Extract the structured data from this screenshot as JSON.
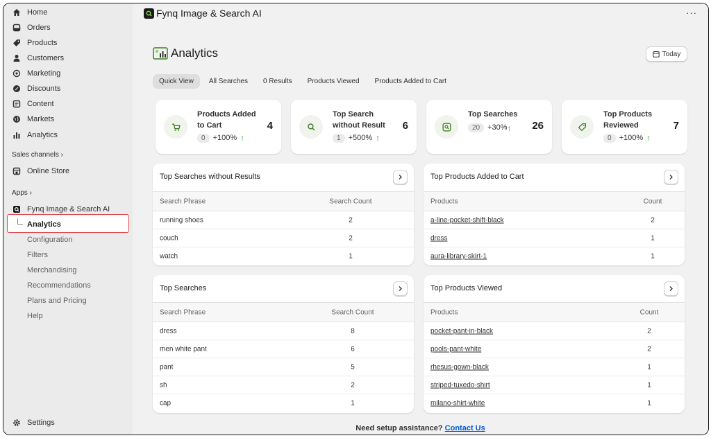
{
  "sidebar": {
    "items": [
      {
        "label": "Home",
        "icon": "home-icon"
      },
      {
        "label": "Orders",
        "icon": "orders-icon"
      },
      {
        "label": "Products",
        "icon": "tag-icon"
      },
      {
        "label": "Customers",
        "icon": "person-icon"
      },
      {
        "label": "Marketing",
        "icon": "target-icon"
      },
      {
        "label": "Discounts",
        "icon": "discount-icon"
      },
      {
        "label": "Content",
        "icon": "content-icon"
      },
      {
        "label": "Markets",
        "icon": "globe-icon"
      },
      {
        "label": "Analytics",
        "icon": "bar-chart-icon"
      }
    ],
    "sales_channels_label": "Sales channels",
    "online_store_label": "Online Store",
    "apps_label": "Apps",
    "app_name": "Fynq Image & Search AI",
    "app_sub_items": [
      "Analytics",
      "Configuration",
      "Filters",
      "Merchandising",
      "Recommendations",
      "Plans and Pricing",
      "Help"
    ],
    "settings_label": "Settings"
  },
  "topbar": {
    "app_title": "Fynq Image & Search AI",
    "more": "···"
  },
  "page": {
    "title": "Analytics",
    "today_label": "Today"
  },
  "tabs": [
    "Quick View",
    "All Searches",
    "0 Results",
    "Products Viewed",
    "Products Added to Cart"
  ],
  "stats": [
    {
      "label": "Products Added to Cart",
      "value": "4",
      "prev": "0",
      "change": "+100%",
      "arrow": "↑"
    },
    {
      "label": "Top Search without Result",
      "value": "6",
      "prev": "1",
      "change": "+500%",
      "arrow": "↑"
    },
    {
      "label": "Top Searches",
      "value": "26",
      "prev": "20",
      "change": "+30%",
      "arrow": "↑"
    },
    {
      "label": "Top Products Reviewed",
      "value": "7",
      "prev": "0",
      "change": "+100%",
      "arrow": "↑"
    }
  ],
  "tables": {
    "no_results": {
      "title": "Top Searches without Results",
      "col1": "Search Phrase",
      "col2": "Search Count",
      "rows": [
        [
          "running shoes",
          "2"
        ],
        [
          "couch",
          "2"
        ],
        [
          "watch",
          "1"
        ]
      ]
    },
    "added_to_cart": {
      "title": "Top Products Added to Cart",
      "col1": "Products",
      "col2": "Count",
      "rows": [
        [
          "a-line-pocket-shift-black",
          "2"
        ],
        [
          "dress",
          "1"
        ],
        [
          "aura-library-skirt-1",
          "1"
        ]
      ]
    },
    "top_searches": {
      "title": "Top Searches",
      "col1": "Search Phrase",
      "col2": "Search Count",
      "rows": [
        [
          "dress",
          "8"
        ],
        [
          "men white pant",
          "6"
        ],
        [
          "pant",
          "5"
        ],
        [
          "sh",
          "2"
        ],
        [
          "cap",
          "1"
        ]
      ]
    },
    "products_viewed": {
      "title": "Top Products Viewed",
      "col1": "Products",
      "col2": "Count",
      "rows": [
        [
          "pocket-pant-in-black",
          "2"
        ],
        [
          "pools-pant-white",
          "2"
        ],
        [
          "rhesus-gown-black",
          "1"
        ],
        [
          "striped-tuxedo-shirt",
          "1"
        ],
        [
          "milano-shirt-white",
          "1"
        ]
      ]
    }
  },
  "footer": {
    "text": "Need setup assistance?",
    "link": "Contact Us"
  },
  "colors": {
    "accent_green": "#29a329",
    "highlight_red": "#e5484d",
    "link_blue": "#005bd3"
  }
}
